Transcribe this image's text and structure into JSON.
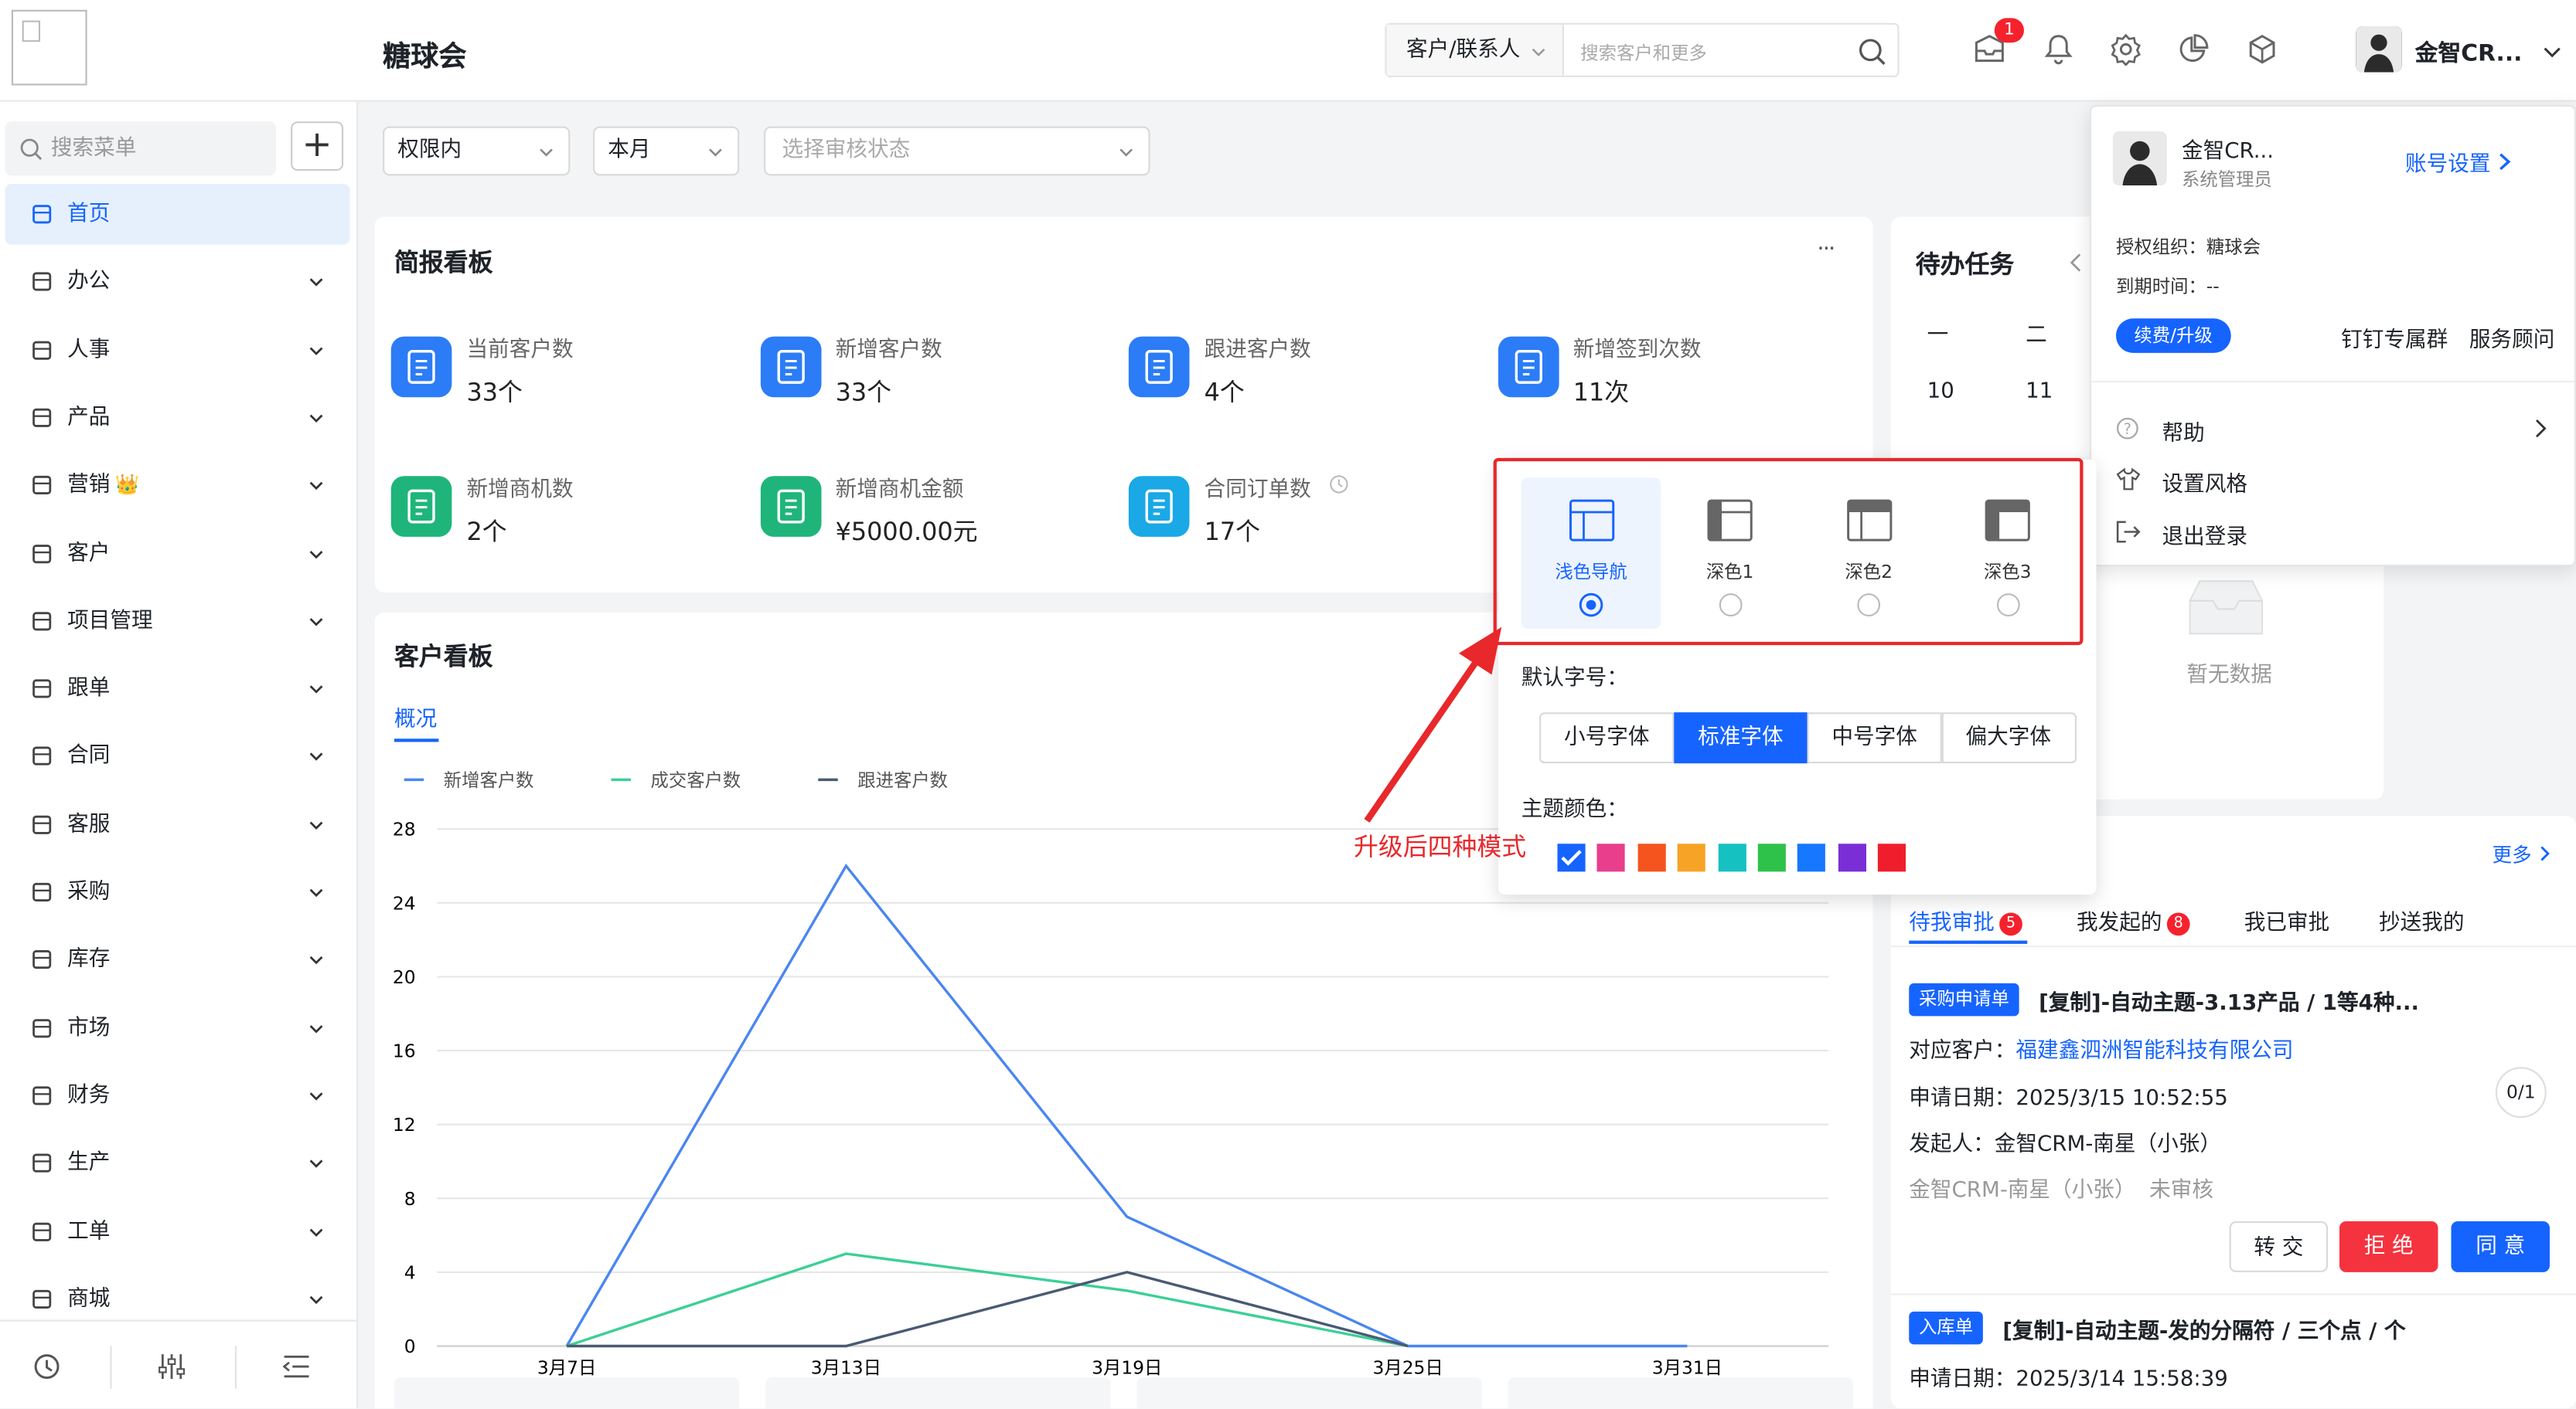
{
  "header": {
    "app_title": "糖球会",
    "search_type": "客户/联系人",
    "search_placeholder": "搜索客户和更多",
    "message_count": "1",
    "user_name": "金智CR..."
  },
  "sidebar": {
    "search_placeholder": "搜索菜单",
    "add_symbol": "+",
    "items": [
      {
        "label": "首页",
        "icon": "home-icon",
        "active": true
      },
      {
        "label": "办公",
        "icon": "office-icon"
      },
      {
        "label": "人事",
        "icon": "hr-icon"
      },
      {
        "label": "产品",
        "icon": "product-icon"
      },
      {
        "label": "营销",
        "icon": "marketing-icon",
        "crown": "👑"
      },
      {
        "label": "客户",
        "icon": "customer-icon"
      },
      {
        "label": "项目管理",
        "icon": "project-icon"
      },
      {
        "label": "跟单",
        "icon": "tracking-icon"
      },
      {
        "label": "合同",
        "icon": "contract-icon"
      },
      {
        "label": "客服",
        "icon": "service-icon"
      },
      {
        "label": "采购",
        "icon": "purchase-icon"
      },
      {
        "label": "库存",
        "icon": "inventory-icon"
      },
      {
        "label": "市场",
        "icon": "market-icon"
      },
      {
        "label": "财务",
        "icon": "finance-icon"
      },
      {
        "label": "生产",
        "icon": "production-icon"
      },
      {
        "label": "工单",
        "icon": "workorder-icon"
      },
      {
        "label": "商城",
        "icon": "mall-icon"
      }
    ],
    "footer_icons": [
      "history-icon",
      "settings-sliders-icon",
      "collapse-icon"
    ]
  },
  "filters": {
    "scope": "权限内",
    "period": "本月",
    "review_placeholder": "选择审核状态"
  },
  "briefing": {
    "title": "简报看板",
    "more": "···",
    "stats": [
      {
        "label": "当前客户数",
        "value": "33个",
        "color": "#2b7cf6"
      },
      {
        "label": "新增客户数",
        "value": "33个",
        "color": "#2b7cf6"
      },
      {
        "label": "跟进客户数",
        "value": "4个",
        "color": "#2b7cf6"
      },
      {
        "label": "新增签到次数",
        "value": "11次",
        "color": "#2b7cf6"
      },
      {
        "label": "新增商机数",
        "value": "2个",
        "color": "#1fb57a"
      },
      {
        "label": "新增商机金额",
        "value": "¥5000.00元",
        "color": "#1fb57a"
      },
      {
        "label": "合同订单数",
        "value": "17个",
        "color": "#1aa8e6"
      }
    ]
  },
  "customer_board": {
    "title": "客户看板",
    "tab": "概况"
  },
  "chart_data": {
    "type": "line",
    "x": [
      "3月7日",
      "3月13日",
      "3月19日",
      "3月25日",
      "3月31日"
    ],
    "series": [
      {
        "name": "新增客户数",
        "color": "#4a86f0",
        "values": [
          0,
          26,
          7,
          0,
          0
        ]
      },
      {
        "name": "成交客户数",
        "color": "#3ccf97",
        "values": [
          0,
          5,
          3,
          0,
          null
        ]
      },
      {
        "name": "跟进客户数",
        "color": "#4a5a73",
        "values": [
          0,
          0,
          4,
          0,
          null
        ]
      }
    ],
    "yticks": [
      0,
      4,
      8,
      12,
      16,
      20,
      24,
      28
    ],
    "ylim": [
      0,
      28
    ],
    "grid": true,
    "legend": "top-left"
  },
  "todo": {
    "title": "待办任务",
    "weekdays": [
      "一",
      "二"
    ],
    "dates": [
      "10",
      "11"
    ],
    "empty": "暂无数据"
  },
  "user_panel": {
    "name": "金智CR...",
    "role": "系统管理员",
    "account_settings": "账号设置",
    "org_label": "授权组织：糖球会",
    "expire_label": "到期时间：--",
    "renew": "续费/升级",
    "dingtalk": "钉钉专属群",
    "advisor": "服务顾问",
    "menu": [
      {
        "label": "帮助",
        "icon": "help-icon"
      },
      {
        "label": "设置风格",
        "icon": "style-icon"
      },
      {
        "label": "退出登录",
        "icon": "logout-icon"
      }
    ]
  },
  "style_panel": {
    "modes": [
      {
        "label": "浅色导航",
        "selected": true
      },
      {
        "label": "深色1",
        "selected": false
      },
      {
        "label": "深色2",
        "selected": false
      },
      {
        "label": "深色3",
        "selected": false
      }
    ],
    "font_size_label": "默认字号：",
    "font_sizes": [
      "小号字体",
      "标准字体",
      "中号字体",
      "偏大字体"
    ],
    "font_selected": 1,
    "theme_label": "主题颜色：",
    "theme_colors": [
      "#1664ff",
      "#e83e8c",
      "#f5541f",
      "#f7a325",
      "#15c1c1",
      "#2fc24a",
      "#1677ff",
      "#7a2fd6",
      "#f01e2c"
    ],
    "annotation": "升级后四种模式",
    "annotation_color": "#e8282b"
  },
  "approval": {
    "more": "更多",
    "tabs": [
      {
        "label": "待我审批",
        "badge": "5",
        "active": true
      },
      {
        "label": "我发起的",
        "badge": "8"
      },
      {
        "label": "我已审批"
      },
      {
        "label": "抄送我的"
      }
    ],
    "item1": {
      "tag": "采购申请单",
      "title": "[复制]-自动主题-3.13产品 / 1等4种...",
      "customer_label": "对应客户：",
      "customer": "福建鑫泗洲智能科技有限公司",
      "date": "申请日期：2025/3/15 10:52:55",
      "progress": "0/1",
      "initiator": "发起人：金智CRM-南星（小张）",
      "status": "金智CRM-南星（小张）  未审核",
      "transfer": "转 交",
      "reject": "拒 绝",
      "agree": "同 意"
    },
    "item2": {
      "tag": "入库单",
      "title": "[复制]-自动主题-发的分隔符 / 三个点 / 个",
      "date": "申请日期：2025/3/14 15:58:39"
    }
  }
}
